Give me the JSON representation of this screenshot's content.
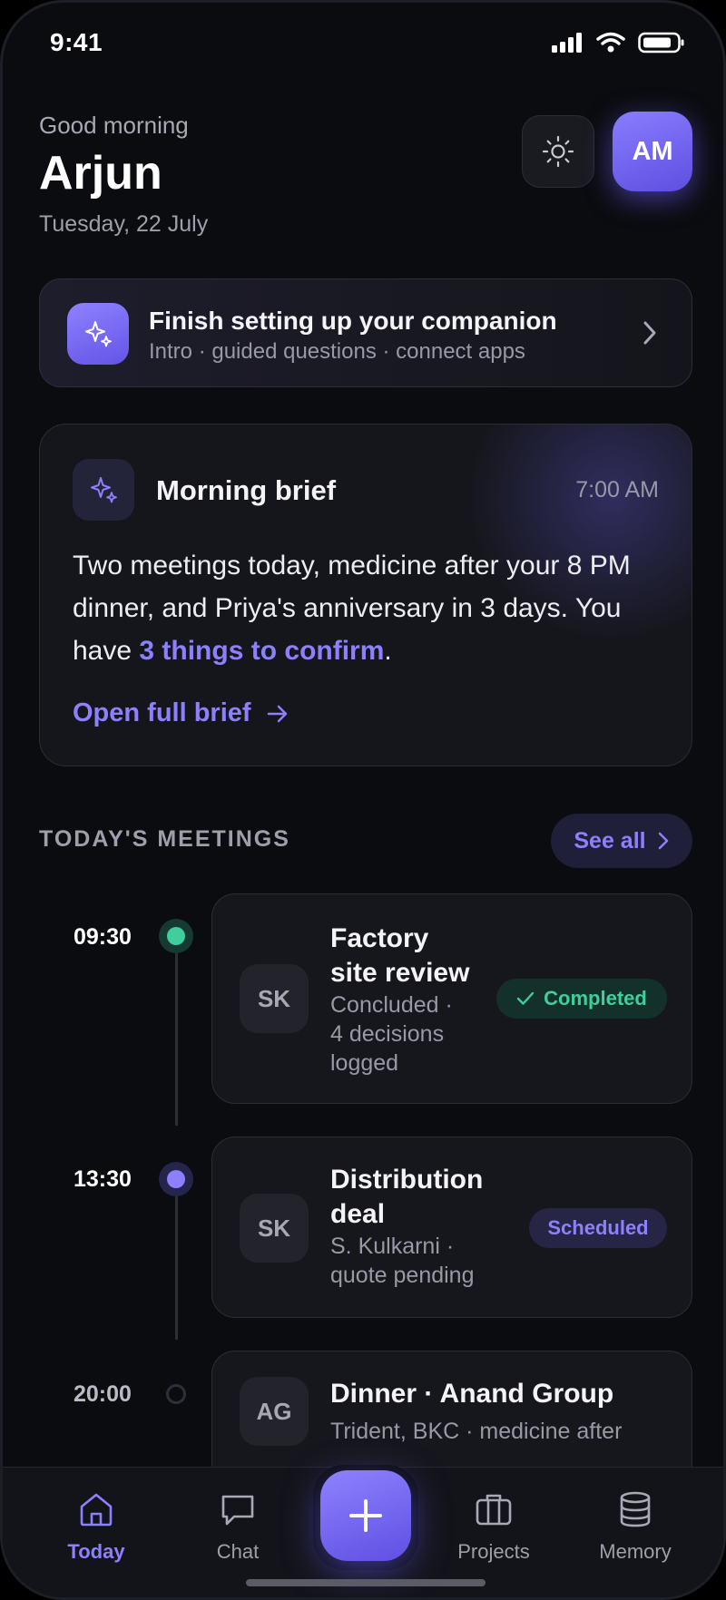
{
  "status_bar": {
    "time": "9:41",
    "icons": [
      "signal-icon",
      "wifi-icon",
      "battery-icon"
    ]
  },
  "header": {
    "greeting": "Good morning",
    "name": "Arjun",
    "date": "Tuesday, 22 July",
    "theme_icon": "sun-icon",
    "avatar_initials": "AM"
  },
  "setup_banner": {
    "icon": "sparkles-icon",
    "title": "Finish setting up your companion",
    "subtitle": "Intro · guided questions · connect apps"
  },
  "brief": {
    "icon": "sparkles-icon",
    "title": "Morning brief",
    "time": "7:00 AM",
    "body_text": "Two meetings today, medicine after your 8 PM dinner, and Priya's anniversary in 3 days. You have ",
    "body_link": "3 things to confirm",
    "body_end": ".",
    "open_label": "Open full brief"
  },
  "meetings": {
    "section_title": "TODAY'S MEETINGS",
    "see_all_label": "See all",
    "items": [
      {
        "time": "09:30",
        "initials": "SK",
        "title_lines": [
          "Factory",
          "site review"
        ],
        "sub_lines": [
          "Concluded ·",
          "4 decisions",
          "logged"
        ],
        "status": "Completed",
        "status_color": "#3fcf9c"
      },
      {
        "time": "13:30",
        "initials": "SK",
        "title_lines": [
          "Distribution",
          "deal"
        ],
        "sub_lines": [
          "S. Kulkarni ·",
          "quote pending"
        ],
        "status": "Scheduled",
        "status_color": "#8c80ff"
      },
      {
        "time": "20:00",
        "initials": "AG",
        "title_lines": [
          "Dinner · Anand Group"
        ],
        "sub_lines": [
          "Trident, BKC · medicine after"
        ],
        "status": "",
        "status_color": ""
      }
    ]
  },
  "nav": {
    "items": [
      {
        "label": "Today",
        "icon": "home-icon",
        "active": true
      },
      {
        "label": "Chat",
        "icon": "chat-icon",
        "active": false
      },
      {
        "label": "Projects",
        "icon": "briefcase-icon",
        "active": false
      },
      {
        "label": "Memory",
        "icon": "database-icon",
        "active": false
      }
    ],
    "fab_icon": "plus-icon"
  },
  "colors": {
    "accent": "#8c80ff",
    "success": "#3fcf9c",
    "background": "#0b0c10",
    "card": "#16171d"
  }
}
